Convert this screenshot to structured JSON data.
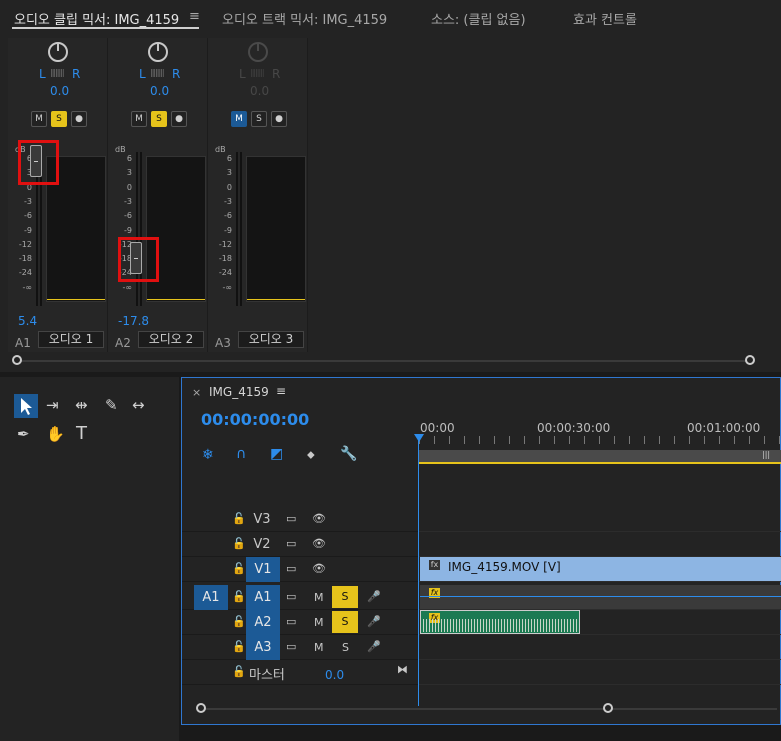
{
  "tabs": [
    {
      "label": "오디오 클립 믹서: IMG_4159",
      "menu": "≡"
    },
    {
      "label": "오디오 트랙 믹서: IMG_4159"
    },
    {
      "label": "소스: (클립 없음)"
    },
    {
      "label": "효과 컨트롤"
    }
  ],
  "mixer": {
    "strips": [
      {
        "l": "L",
        "r": "R",
        "pan": "0.0",
        "m": "M",
        "s": "S",
        "r_btn": "●",
        "db": "dB",
        "volume": "5.4",
        "track_id": "A1",
        "track_name": "오디오 1",
        "fader_db": 5.4
      },
      {
        "l": "L",
        "r": "R",
        "pan": "0.0",
        "m": "M",
        "s": "S",
        "r_btn": "●",
        "db": "dB",
        "volume": "-17.8",
        "track_id": "A2",
        "track_name": "오디오 2",
        "fader_db": -17.8
      },
      {
        "l": "L",
        "r": "R",
        "pan": "0.0",
        "m": "M",
        "s": "S",
        "r_btn": "●",
        "db": "dB",
        "volume": "",
        "track_id": "A3",
        "track_name": "오디오 3",
        "fader_db": 0
      }
    ],
    "scale": [
      "6",
      "3",
      "0",
      "-3",
      "-6",
      "-9",
      "-12",
      "-18",
      "-24",
      "-∞"
    ]
  },
  "timeline": {
    "title": "IMG_4159",
    "menu": "≡",
    "close": "×",
    "timecode": "00:00:00:00",
    "ruler": [
      "00:00",
      "00:00:30:00",
      "00:01:00:00"
    ],
    "video_tracks": [
      {
        "name": "V3",
        "lock": "🔓",
        "eye": "👁"
      },
      {
        "name": "V2",
        "lock": "🔓",
        "eye": "👁"
      },
      {
        "name": "V1",
        "lock": "🔓",
        "eye": "👁"
      }
    ],
    "audio_tracks": [
      {
        "src": "A1",
        "name": "A1",
        "m": "M",
        "s": "S"
      },
      {
        "src": "",
        "name": "A2",
        "m": "M",
        "s": "S"
      },
      {
        "src": "",
        "name": "A3",
        "m": "M",
        "s": "S"
      }
    ],
    "master_label": "마스터",
    "master_value": "0.0",
    "video_clip": "IMG_4159.MOV [V]",
    "fx": "fx"
  },
  "colors": {
    "accent": "#2d8ceb",
    "solo": "#e6c31b",
    "target": "#1c5a96",
    "highlight": "#e01010"
  }
}
